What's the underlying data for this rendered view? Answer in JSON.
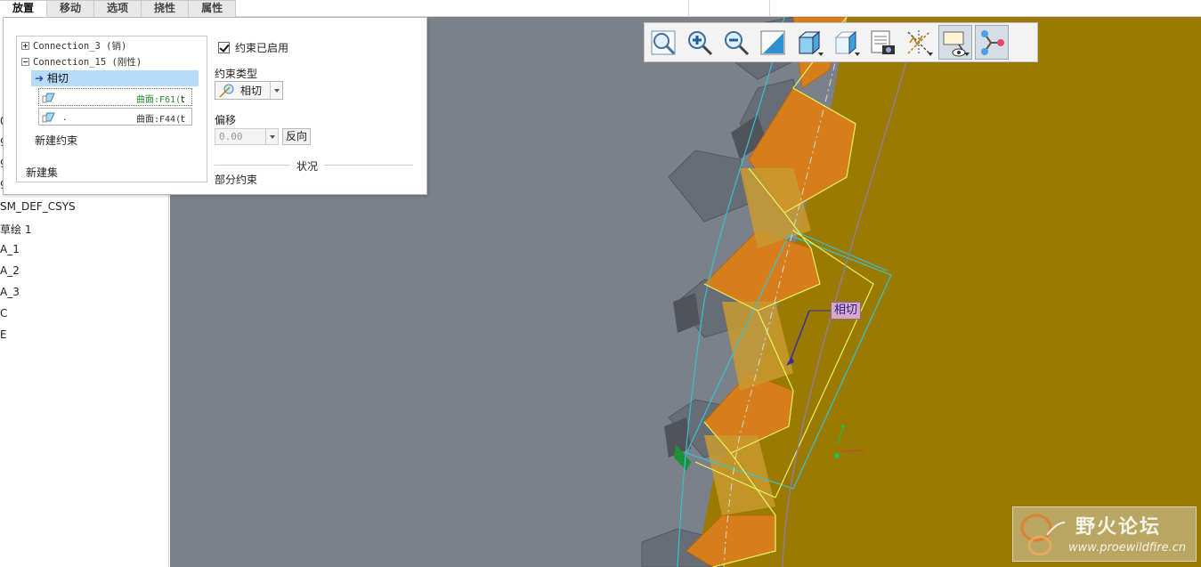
{
  "tabs": [
    {
      "label": "放置",
      "active": true
    },
    {
      "label": "移动",
      "active": false
    },
    {
      "label": "选项",
      "active": false
    },
    {
      "label": "挠性",
      "active": false
    },
    {
      "label": "属性",
      "active": false
    }
  ],
  "model_tree": {
    "items": [
      "0",
      "9",
      "9",
      "9",
      "SM_DEF_CSYS",
      "草绘 1",
      "A_1",
      "A_2",
      "A_3",
      "C",
      "E"
    ]
  },
  "placement": {
    "sets": {
      "connection_3": "Connection_3 (销)",
      "connection_15": "Connection_15 (刚性)",
      "selected_constraint": "相切",
      "ref1": {
        "dot": "",
        "surface": "曲面:F61(",
        "suffix": "t"
      },
      "ref2": {
        "dot": ".",
        "surface": "曲面:F44(",
        "suffix": "t"
      },
      "new_constraint": "新建约束",
      "new_set": "新建集"
    },
    "constraint_enabled_label": "约束已启用",
    "constraint_type_label": "约束类型",
    "constraint_type_value": "相切",
    "offset_label": "偏移",
    "offset_value": "0.00",
    "flip_button": "反向",
    "status_label": "状况",
    "status_value": "部分约束"
  },
  "viewport": {
    "tag_label": "相切",
    "colors": {
      "background": "#7c8089",
      "gold_part": "#9b7a02",
      "tooth_orange": "#d77e1c",
      "gray_gear": "#686c74",
      "cyan_edge": "#33c4d4",
      "yellow_edge": "#e9f55a"
    }
  },
  "view_toolbar": {
    "buttons": [
      {
        "name": "refit-icon",
        "pressed": false,
        "drop": false
      },
      {
        "name": "zoom-in-icon",
        "pressed": false,
        "drop": false
      },
      {
        "name": "zoom-out-icon",
        "pressed": false,
        "drop": false
      },
      {
        "name": "repaint-icon",
        "pressed": false,
        "drop": false
      },
      {
        "name": "display-style-icon",
        "pressed": false,
        "drop": true
      },
      {
        "name": "saved-orientations-icon",
        "pressed": false,
        "drop": true
      },
      {
        "name": "view-manager-icon",
        "pressed": false,
        "drop": false
      },
      {
        "name": "datum-display-icon",
        "pressed": false,
        "drop": true
      },
      {
        "name": "annotation-display-icon",
        "pressed": true,
        "drop": true
      },
      {
        "name": "spin-center-icon",
        "pressed": true,
        "drop": false
      }
    ]
  },
  "watermark": {
    "title": "野火论坛",
    "url": "www.proewildfire.cn"
  }
}
